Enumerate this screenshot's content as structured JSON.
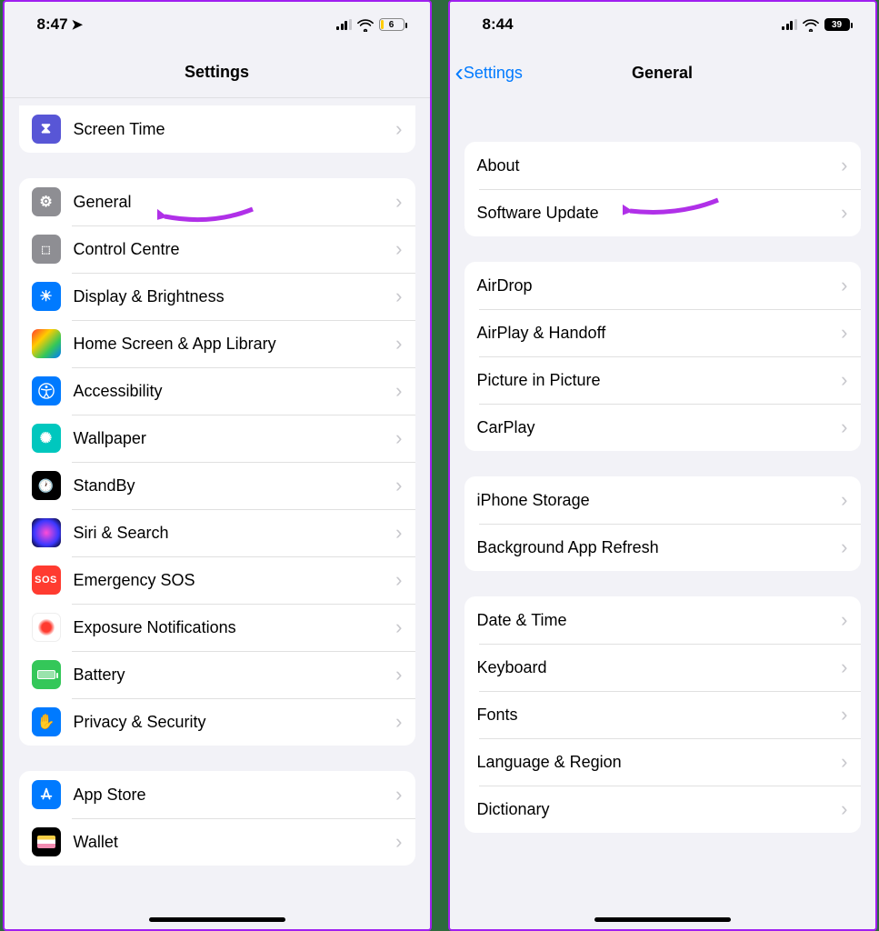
{
  "left": {
    "statusTime": "8:47",
    "battery": "6",
    "navTitle": "Settings",
    "group0": [
      {
        "label": "Screen Time",
        "iconClass": "ic-screentime",
        "glyph": "⧗"
      }
    ],
    "group1": [
      {
        "label": "General",
        "iconClass": "ic-general",
        "glyph": "⚙"
      },
      {
        "label": "Control Centre",
        "iconClass": "ic-control",
        "glyph": "⋮⋮"
      },
      {
        "label": "Display & Brightness",
        "iconClass": "ic-display",
        "glyph": "☀"
      },
      {
        "label": "Home Screen & App Library",
        "iconClass": "ic-home",
        "glyph": ""
      },
      {
        "label": "Accessibility",
        "iconClass": "ic-access",
        "glyph": "⦿"
      },
      {
        "label": "Wallpaper",
        "iconClass": "ic-wallpaper",
        "glyph": "✺"
      },
      {
        "label": "StandBy",
        "iconClass": "ic-standby",
        "glyph": "◑"
      },
      {
        "label": "Siri & Search",
        "iconClass": "ic-siri",
        "glyph": ""
      },
      {
        "label": "Emergency SOS",
        "iconClass": "ic-sos",
        "glyph": "SOS"
      },
      {
        "label": "Exposure Notifications",
        "iconClass": "ic-exposure",
        "glyph": ""
      },
      {
        "label": "Battery",
        "iconClass": "ic-battery",
        "glyph": ""
      },
      {
        "label": "Privacy & Security",
        "iconClass": "ic-privacy",
        "glyph": "✋"
      }
    ],
    "group2": [
      {
        "label": "App Store",
        "iconClass": "ic-appstore",
        "glyph": "A"
      },
      {
        "label": "Wallet",
        "iconClass": "ic-wallet",
        "glyph": ""
      }
    ]
  },
  "right": {
    "statusTime": "8:44",
    "battery": "39",
    "backLabel": "Settings",
    "navTitle": "General",
    "group0": [
      {
        "label": "About"
      },
      {
        "label": "Software Update"
      }
    ],
    "group1": [
      {
        "label": "AirDrop"
      },
      {
        "label": "AirPlay & Handoff"
      },
      {
        "label": "Picture in Picture"
      },
      {
        "label": "CarPlay"
      }
    ],
    "group2": [
      {
        "label": "iPhone Storage"
      },
      {
        "label": "Background App Refresh"
      }
    ],
    "group3": [
      {
        "label": "Date & Time"
      },
      {
        "label": "Keyboard"
      },
      {
        "label": "Fonts"
      },
      {
        "label": "Language & Region"
      },
      {
        "label": "Dictionary"
      }
    ]
  }
}
